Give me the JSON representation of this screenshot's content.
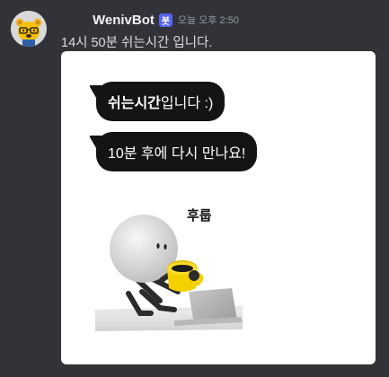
{
  "message": {
    "author": "WenivBot",
    "bot_badge": "봇",
    "timestamp": "오늘 오후 2:50",
    "content": "14시 50분 쉬는시간 입니다."
  },
  "embed": {
    "bubble_1": {
      "bold": "쉬는시간",
      "regular": "입니다 :)"
    },
    "bubble_2": {
      "text": "10분 후에 다시 만나요!"
    },
    "sticker_caption": "후룹"
  },
  "colors": {
    "background": "#313338",
    "username": "#f2f3f5",
    "bot_badge": "#5865f2",
    "timestamp": "#949ba4",
    "message_text": "#dbdee1",
    "embed_background": "#ffffff",
    "bubble": "#141414",
    "mug": "#f5d000"
  },
  "icons": {
    "avatar": "cartoon-bear-avatar",
    "sticker": "3d-character-drinking-at-laptop"
  }
}
